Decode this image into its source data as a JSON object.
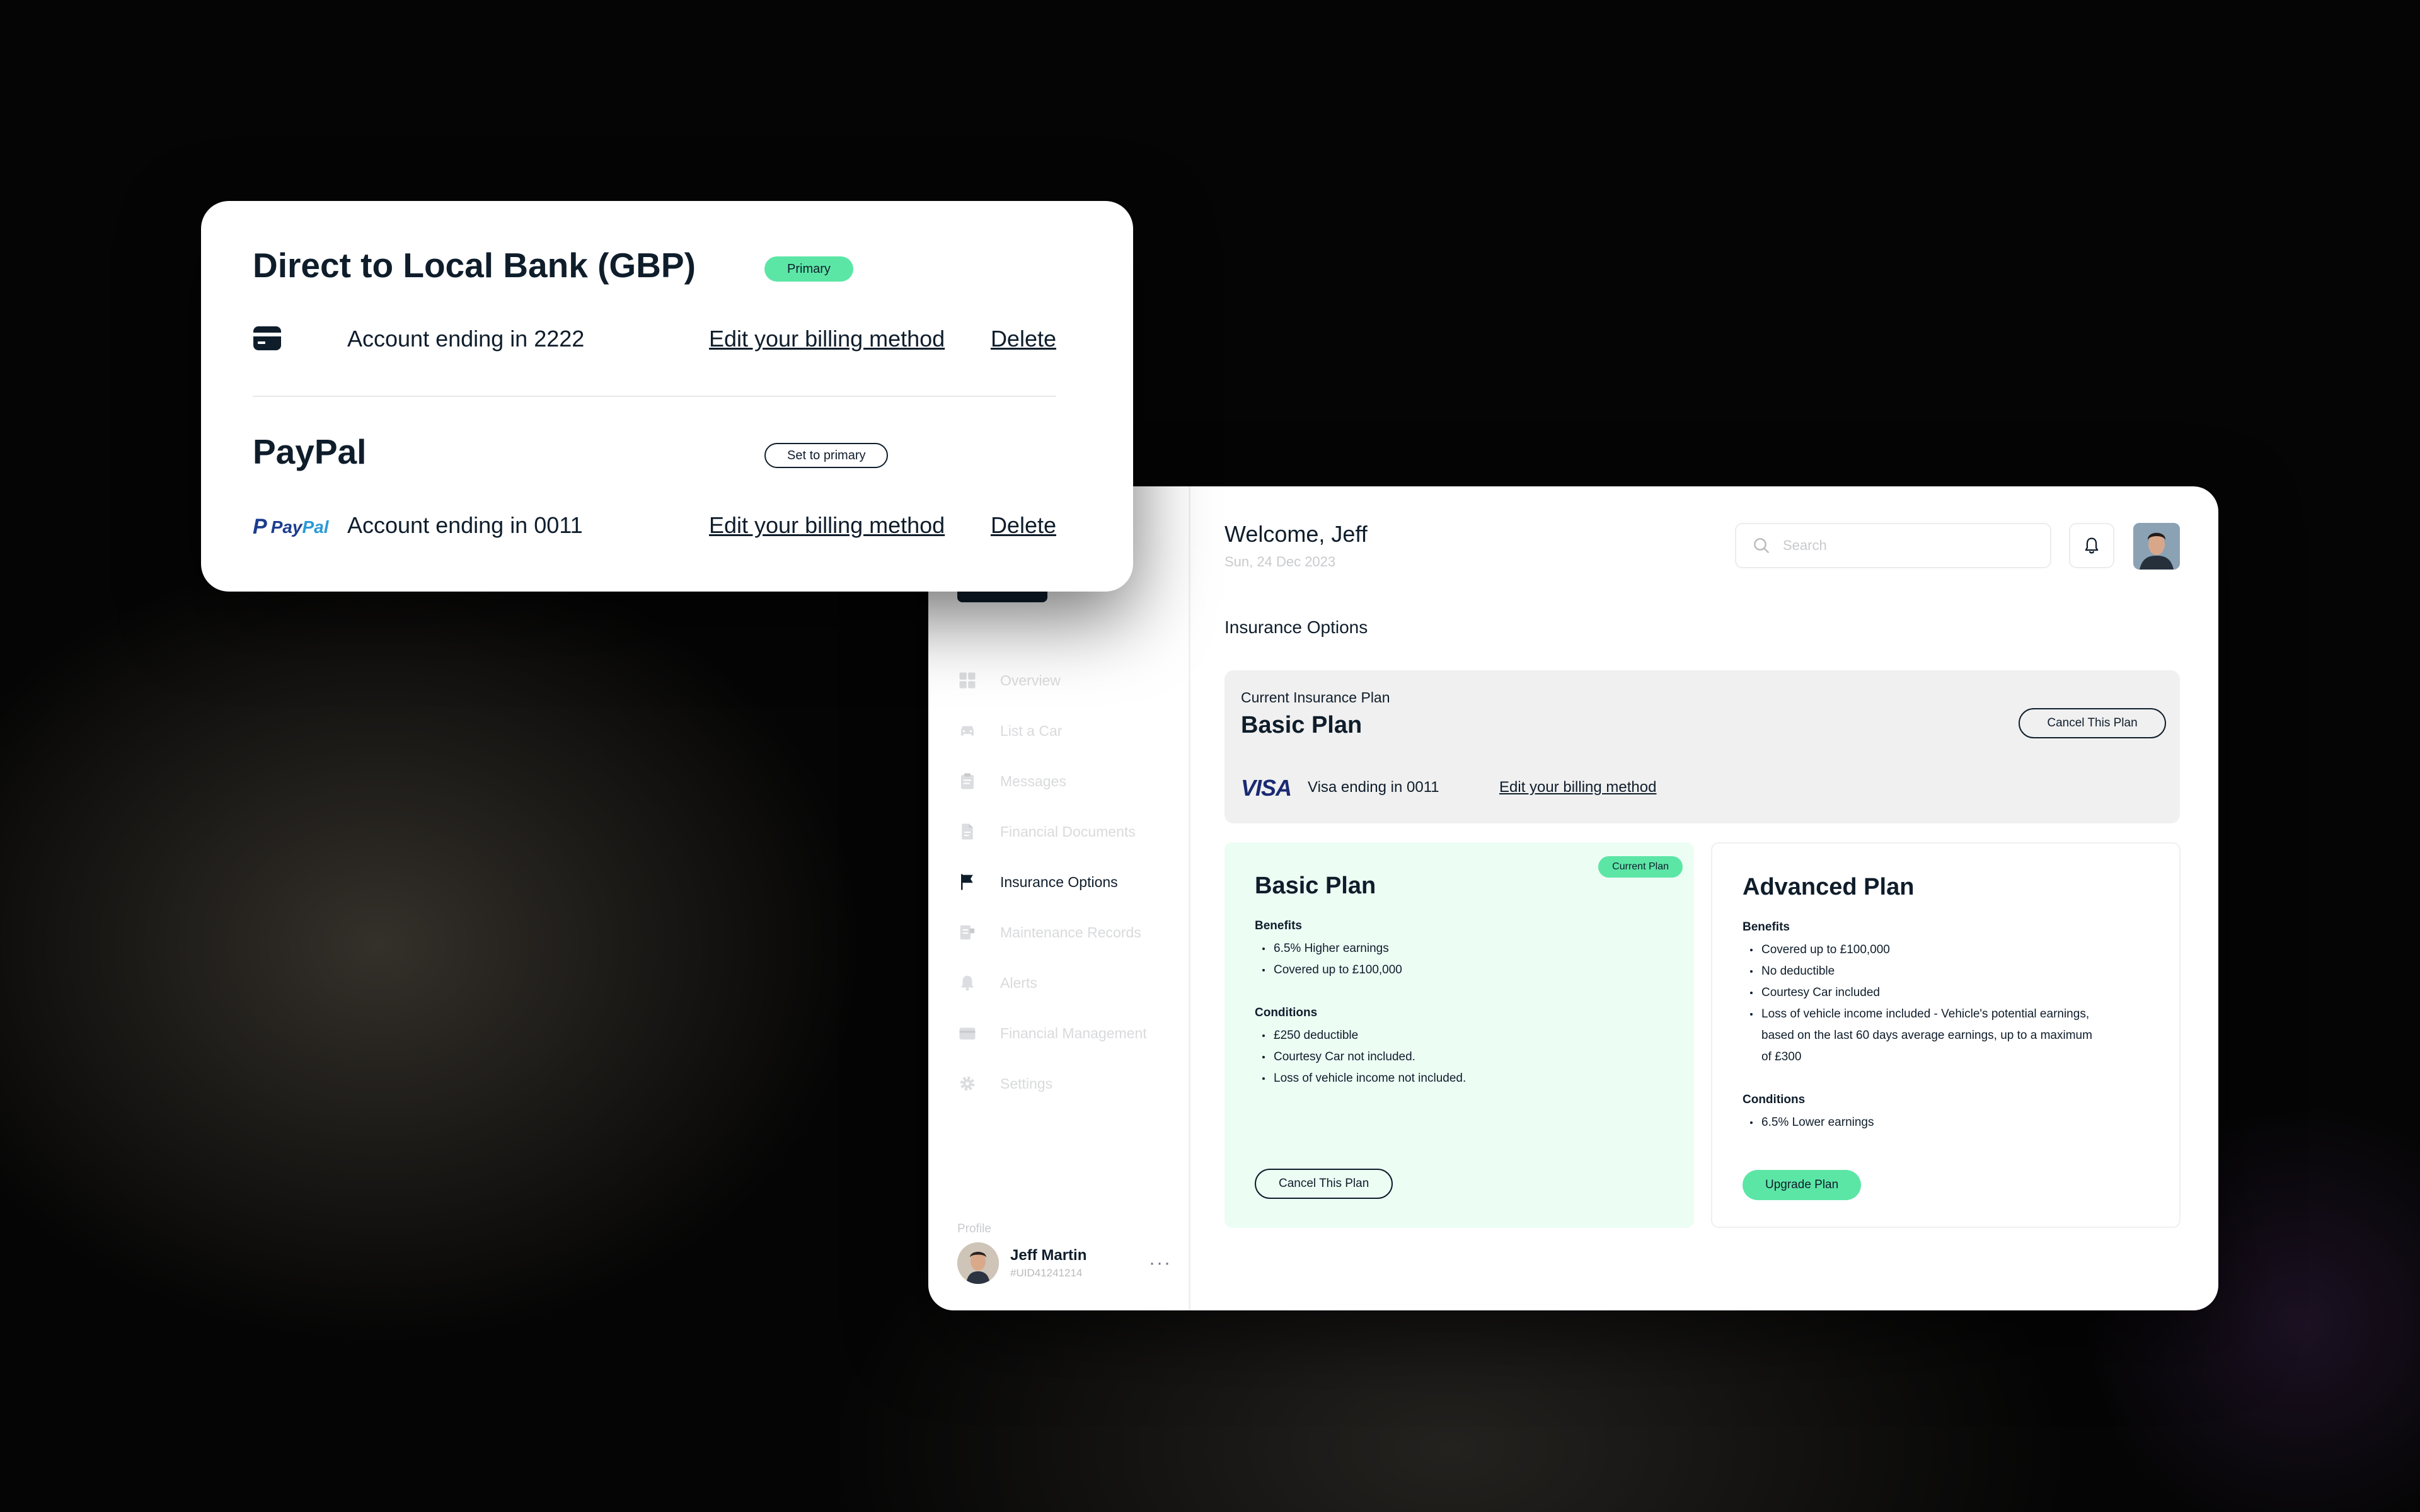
{
  "dashboard": {
    "welcome": "Welcome, Jeff",
    "date": "Sun, 24 Dec 2023",
    "search_placeholder": "Search",
    "section_title": "Insurance Options",
    "nav": [
      {
        "label": "Overview",
        "icon": "grid-icon",
        "active": false
      },
      {
        "label": "List a Car",
        "icon": "car-icon",
        "active": false
      },
      {
        "label": "Messages",
        "icon": "clipboard-icon",
        "active": false
      },
      {
        "label": "Financial Documents",
        "icon": "document-icon",
        "active": false
      },
      {
        "label": "Insurance Options",
        "icon": "flag-icon",
        "active": true
      },
      {
        "label": "Maintenance Records",
        "icon": "records-icon",
        "active": false
      },
      {
        "label": "Alerts",
        "icon": "bell-icon",
        "active": false
      },
      {
        "label": "Financial Management",
        "icon": "wallet-icon",
        "active": false
      },
      {
        "label": "Settings",
        "icon": "gear-icon",
        "active": false
      }
    ],
    "profile": {
      "caption": "Profile",
      "name": "Jeff Martin",
      "uid": "#UID41241214"
    },
    "current_plan": {
      "label": "Current Insurance Plan",
      "name": "Basic Plan",
      "cancel_label": "Cancel This Plan",
      "card_brand": "VISA",
      "card_text": "Visa ending in 0011",
      "billing_link": "Edit your billing method"
    },
    "plans": [
      {
        "title": "Basic Plan",
        "badge": "Current Plan",
        "benefits_label": "Benefits",
        "benefits": [
          "6.5% Higher earnings",
          "Covered up to £100,000"
        ],
        "conditions_label": "Conditions",
        "conditions": [
          "£250 deductible",
          "Courtesy Car not included.",
          "Loss of vehicle income not included."
        ],
        "button": "Cancel This Plan"
      },
      {
        "title": "Advanced Plan",
        "benefits_label": "Benefits",
        "benefits": [
          "Covered up to £100,000",
          "No deductible",
          "Courtesy Car included",
          "Loss of vehicle income included - Vehicle's potential earnings, based on the last 60 days average earnings, up to a maximum of £300"
        ],
        "conditions_label": "Conditions",
        "conditions": [
          "6.5% Lower earnings"
        ],
        "button": "Upgrade Plan"
      }
    ]
  },
  "billing": {
    "methods": [
      {
        "title": "Direct to Local Bank (GBP)",
        "badge": "Primary",
        "icon": "credit-card-icon",
        "account": "Account ending in 2222",
        "edit_label": "Edit your billing method",
        "delete_label": "Delete"
      },
      {
        "title": "PayPal",
        "badge": "Set to primary",
        "logo": {
          "mark": "P",
          "pay": "Pay",
          "pal": "Pal"
        },
        "account": "Account ending in 0011",
        "edit_label": "Edit your billing method",
        "delete_label": "Delete"
      }
    ]
  },
  "colors": {
    "navy": "#0f1d2b",
    "accent_green": "#5ce6a6",
    "mint_bg": "#ecfdf4",
    "visa_blue": "#1a2a72",
    "paypal_dark": "#1b3d8f",
    "paypal_light": "#2a9ad8"
  }
}
